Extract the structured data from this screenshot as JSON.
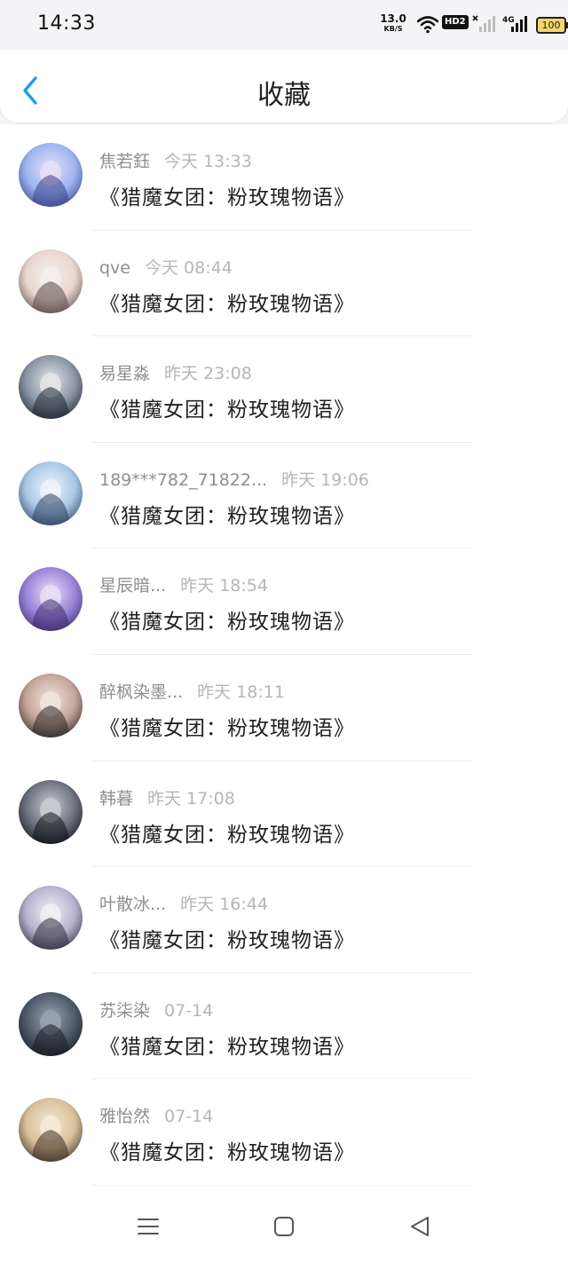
{
  "status": {
    "time": "14:33",
    "speed_value": "13.0",
    "speed_unit": "KB/S",
    "hd_label": "HD2",
    "battery": "100",
    "network_label": "4G"
  },
  "header": {
    "title": "收藏",
    "back_icon": "chevron-left-icon"
  },
  "accent": "#1e9bf0",
  "favorites": [
    {
      "name": "焦若鈺",
      "time": "今天 13:33",
      "book": "《猎魔女团：粉玫瑰物语》",
      "avatar_colors": [
        "#3a3f8a",
        "#9fb6f0",
        "#e8dff7"
      ]
    },
    {
      "name": "qve",
      "time": "今天 08:44",
      "book": "《猎魔女团：粉玫瑰物语》",
      "avatar_colors": [
        "#5a4a48",
        "#e9d7cf",
        "#f5eeee"
      ]
    },
    {
      "name": "易星淼",
      "time": "昨天 23:08",
      "book": "《猎魔女团：粉玫瑰物语》",
      "avatar_colors": [
        "#1d2430",
        "#8b96a6",
        "#e5e6ea"
      ]
    },
    {
      "name": "189***782_71822...",
      "time": "昨天 19:06",
      "book": "《猎魔女团：粉玫瑰物语》",
      "avatar_colors": [
        "#2d3e5c",
        "#a9c9e8",
        "#eef5fb"
      ]
    },
    {
      "name": "星辰暗...",
      "time": "昨天 18:54",
      "book": "《猎魔女团：粉玫瑰物语》",
      "avatar_colors": [
        "#3b2a6a",
        "#9a86d8",
        "#e8e0f6"
      ]
    },
    {
      "name": "醉枫染墨...",
      "time": "昨天 18:11",
      "book": "《猎魔女团：粉玫瑰物语》",
      "avatar_colors": [
        "#2a2527",
        "#c4a69a",
        "#f2e4de"
      ]
    },
    {
      "name": "韩暮",
      "time": "昨天 17:08",
      "book": "《猎魔女团：粉玫瑰物语》",
      "avatar_colors": [
        "#0f1116",
        "#6c7280",
        "#c9ccd3"
      ]
    },
    {
      "name": "叶散冰...",
      "time": "昨天 16:44",
      "book": "《猎魔女团：粉玫瑰物语》",
      "avatar_colors": [
        "#2f2c3a",
        "#b7b4cf",
        "#f0eef6"
      ]
    },
    {
      "name": "苏柒染",
      "time": "07-14",
      "book": "《猎魔女团：粉玫瑰物语》",
      "avatar_colors": [
        "#151a22",
        "#4f5a6a",
        "#98a3b2"
      ]
    },
    {
      "name": "雅怡然",
      "time": "07-14",
      "book": "《猎魔女团：粉玫瑰物语》",
      "avatar_colors": [
        "#3a2d24",
        "#d9c09a",
        "#f6ead8"
      ]
    }
  ],
  "nav": {
    "menu_icon": "menu-icon",
    "home_icon": "square-home-icon",
    "back_icon": "triangle-back-icon"
  }
}
